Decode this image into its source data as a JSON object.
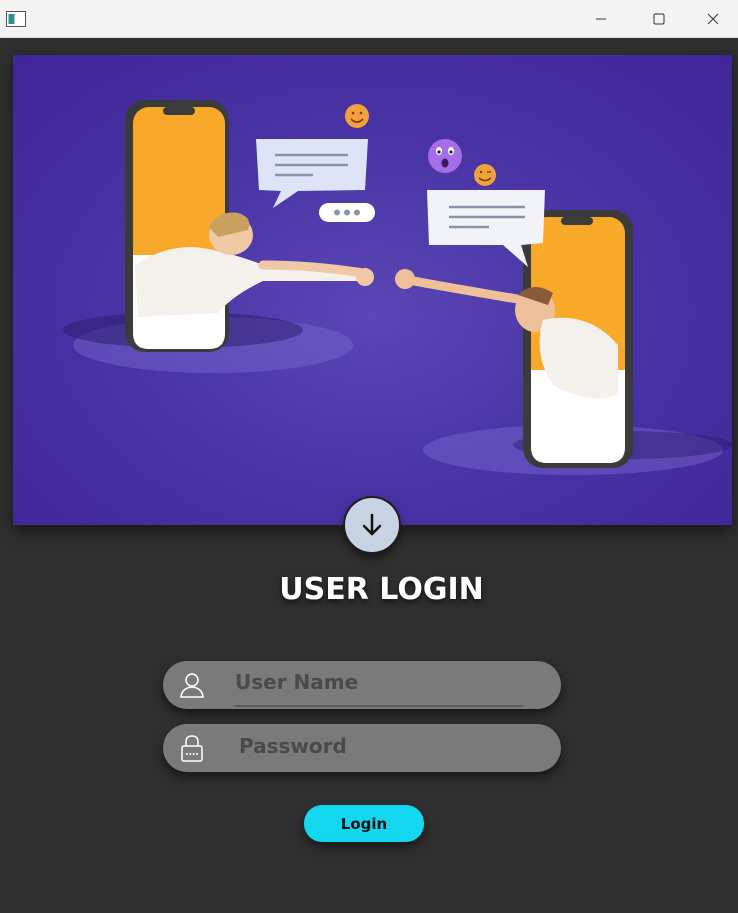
{
  "window": {
    "icon": "app-window-icon",
    "controls": [
      "minimize-icon",
      "maximize-icon",
      "close-icon"
    ]
  },
  "hero": {
    "illustration": "two-phones-chat-illustration",
    "accent": "#4a35a6",
    "phone_screen_color": "#f8a92a"
  },
  "login": {
    "title": "USER LOGIN",
    "username_placeholder": "User Name",
    "password_placeholder": "Password",
    "button_label": "Login",
    "button_color": "#12d7ee"
  },
  "icons": {
    "scroll": "arrow-down-icon",
    "user": "user-icon",
    "password": "lock-icon"
  }
}
